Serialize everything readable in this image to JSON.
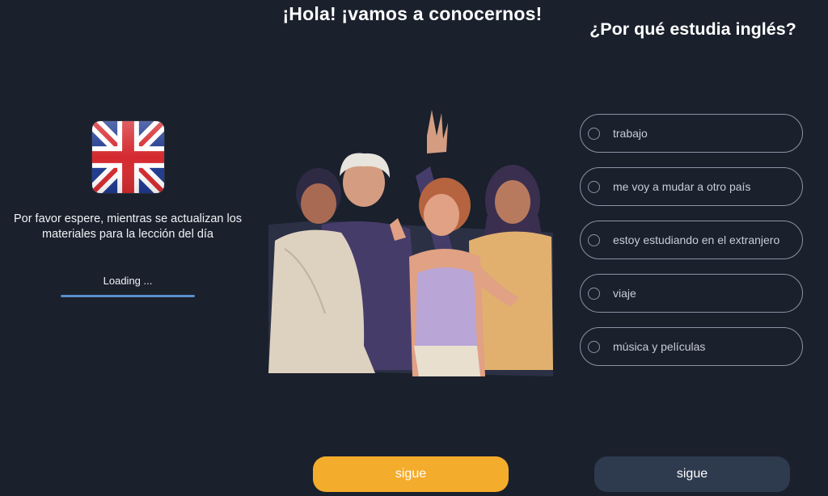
{
  "header": {
    "title": "¡Hola! ¡vamos a conocernos!"
  },
  "loading_panel": {
    "message": "Por favor espere, mientras se actualizan los materiales para la lección del día",
    "loading_label": "Loading ...",
    "progress": 1.0,
    "flag_icon": "uk-flag-icon"
  },
  "illustration": {
    "icon": "group-of-people-illustration"
  },
  "question": {
    "title": "¿Por qué estudia inglés?",
    "options": [
      {
        "label": "trabajo"
      },
      {
        "label": "me voy a mudar a otro país"
      },
      {
        "label": "estoy estudiando en el extranjero"
      },
      {
        "label": "viaje"
      },
      {
        "label": "música y películas"
      }
    ]
  },
  "buttons": {
    "next_orange_label": "sigue",
    "next_gray_label": "sigue"
  },
  "colors": {
    "background": "#1a202c",
    "accent_orange": "#f4ac2c",
    "button_gray": "#2e3a4e",
    "option_border": "#8a94a6",
    "progress_blue": "#5b8fce"
  }
}
